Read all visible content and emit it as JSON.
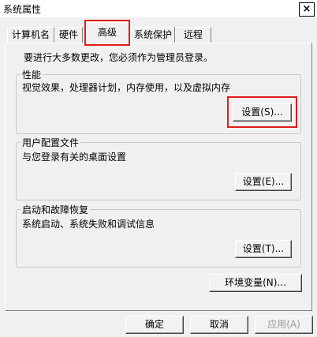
{
  "window": {
    "title": "系统属性",
    "close_glyph": "×"
  },
  "tabs": [
    {
      "label": "计算机名"
    },
    {
      "label": "硬件"
    },
    {
      "label": "高级"
    },
    {
      "label": "系统保护"
    },
    {
      "label": "远程"
    }
  ],
  "intro_text": "要进行大多数更改，您必须作为管理员登录。",
  "performance": {
    "title": "性能",
    "description": "视觉效果，处理器计划，内存使用，以及虚拟内存",
    "settings_label": "设置(S)..."
  },
  "user_profiles": {
    "title": "用户配置文件",
    "description": "与您登录有关的桌面设置",
    "settings_label": "设置(E)..."
  },
  "startup_recovery": {
    "title": "启动和故障恢复",
    "description": "系统启动、系统失败和调试信息",
    "settings_label": "设置(T)..."
  },
  "env_vars_label": "环境变量(N)...",
  "footer": {
    "ok": "确定",
    "cancel": "取消",
    "apply": "应用(A)"
  },
  "highlight_color": "#e01b1b"
}
